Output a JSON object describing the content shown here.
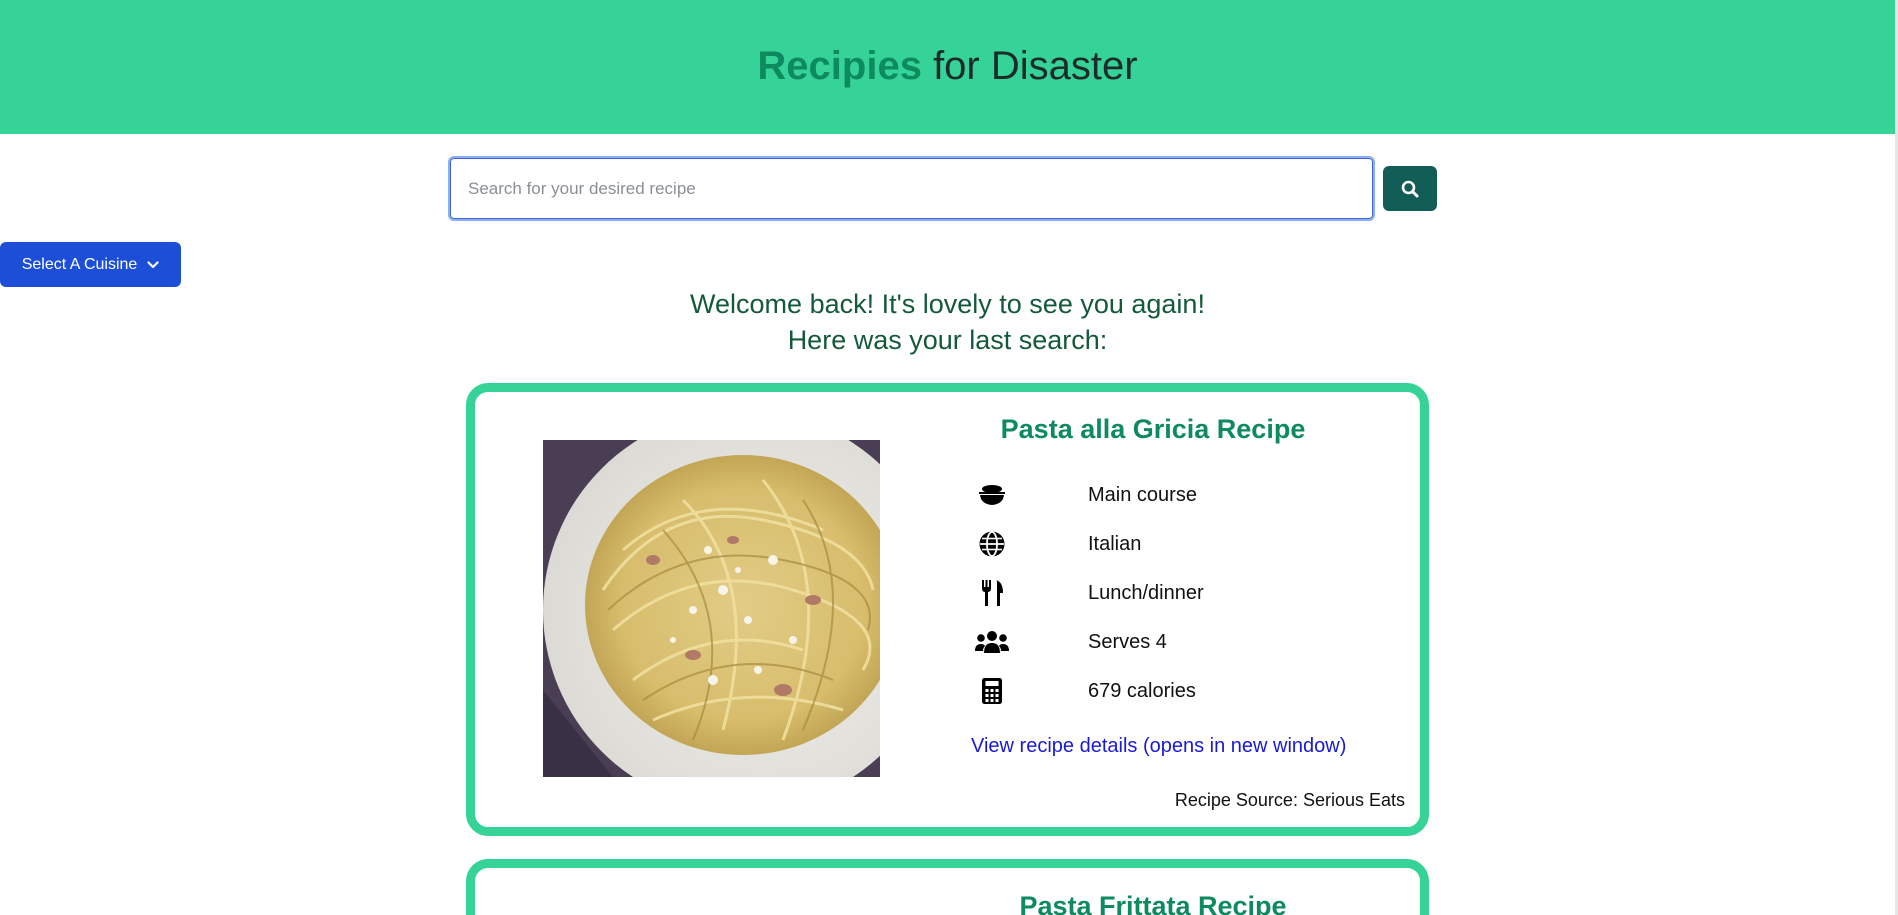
{
  "header": {
    "brand": "Recipies",
    "rest": " for Disaster"
  },
  "search": {
    "placeholder": "Search for your desired recipe",
    "value": ""
  },
  "cuisine_dropdown": {
    "label": "Select A Cuisine"
  },
  "welcome": {
    "line1": "Welcome back! It's lovely to see you again!",
    "line2": "Here was your last search:"
  },
  "recipes": [
    {
      "title": "Pasta alla Gricia Recipe",
      "details": [
        {
          "icon": "bowl-icon",
          "label": "Main course"
        },
        {
          "icon": "globe-icon",
          "label": "Italian"
        },
        {
          "icon": "utensils-icon",
          "label": "Lunch/dinner"
        },
        {
          "icon": "users-icon",
          "label": "Serves 4"
        },
        {
          "icon": "calculator-icon",
          "label": "679 calories"
        }
      ],
      "link_text": "View recipe details (opens in new window)",
      "source": "Recipe Source: Serious Eats"
    },
    {
      "title": "Pasta Frittata Recipe"
    }
  ],
  "colors": {
    "header_bg": "#36d399",
    "brand": "#0e8a5f",
    "search_button": "#125e57",
    "cuisine_button": "#1d4ed8",
    "card_border": "#36d399",
    "link": "#1a1ad4"
  }
}
